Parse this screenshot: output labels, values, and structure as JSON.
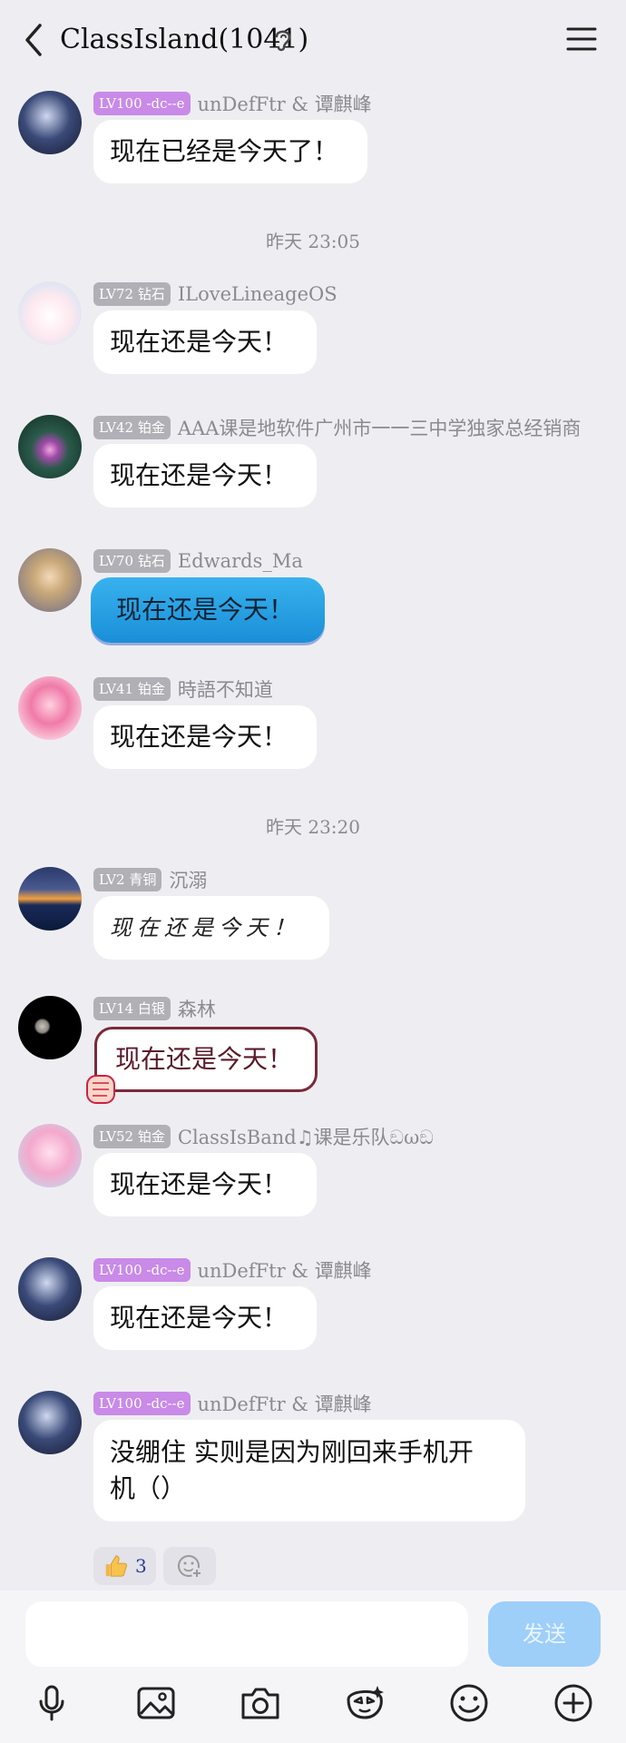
{
  "header": {
    "title": "ClassIsland(1041)"
  },
  "timestamps": [
    "昨天 23:05",
    "昨天 23:20"
  ],
  "messages": [
    {
      "badge": "LV100 -dc--e",
      "nick": "unDefFtr & 谭麒峰",
      "text": "现在已经是今天了！"
    },
    {
      "badge": "LV72 钻石",
      "nick": "ILoveLineageOS",
      "text": "现在还是今天！"
    },
    {
      "badge": "LV42 铂金",
      "nick": "AAA课是地软件广州市一一三中学独家总经销商",
      "text": "现在还是今天！"
    },
    {
      "badge": "LV70 钻石",
      "nick": "Edwards_Ma",
      "text": "现在还是今天！"
    },
    {
      "badge": "LV41 铂金",
      "nick": "時語不知道",
      "text": "现在还是今天！"
    },
    {
      "badge": "LV2 青铜",
      "nick": "沉溺",
      "text": "现在还是今天！"
    },
    {
      "badge": "LV14 白银",
      "nick": "森林",
      "text": "现在还是今天！"
    },
    {
      "badge": "LV52 铂金",
      "nick": "ClassIsBand♫课是乐队ඞωඞ",
      "text": "现在还是今天！"
    },
    {
      "badge": "LV100 -dc--e",
      "nick": "unDefFtr & 谭麒峰",
      "text": "现在还是今天！"
    },
    {
      "badge": "LV100 -dc--e",
      "nick": "unDefFtr & 谭麒峰",
      "text": "没绷住 实则是因为刚回来手机开机（）"
    }
  ],
  "reaction": {
    "count": "3"
  },
  "composer": {
    "input_value": "",
    "send_label": "发送"
  },
  "icons": [
    "back-icon",
    "ear-icon",
    "menu-icon",
    "microphone-icon",
    "image-icon",
    "camera-icon",
    "sticker-icon",
    "emoji-icon",
    "plus-icon"
  ]
}
